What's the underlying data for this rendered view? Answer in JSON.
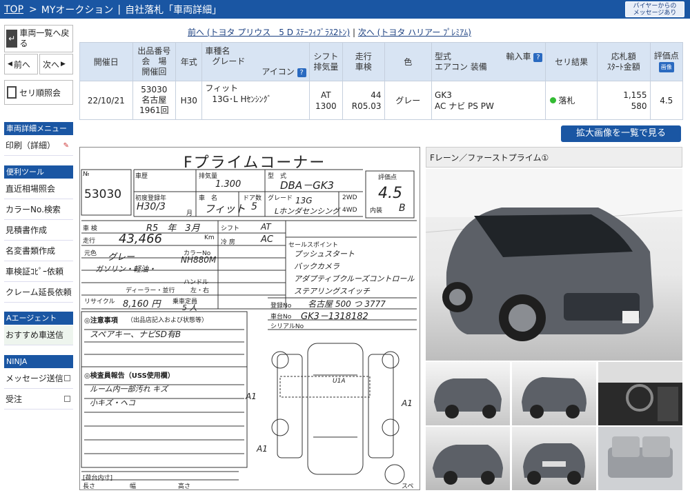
{
  "header": {
    "top_link": "TOP",
    "sep": ">",
    "my": "MYオークション",
    "bar": "|",
    "title": "自社落札「車両詳細」",
    "buyer_msg_line1": "バイヤーからの",
    "buyer_msg_line2": "メッセージあり"
  },
  "sidebar": {
    "back_list": "車両一覧へ戻る",
    "prev": "前へ",
    "next": "次へ",
    "seri": "セリ順照会",
    "menu_head": "車両詳細メニュー",
    "print": "印刷（詳細）",
    "tools_head": "便利ツール",
    "tools": [
      "直近相場照会",
      "カラーNo.検索",
      "見積書作成",
      "名変書類作成",
      "車検証ｺﾋﾟｰ依頼",
      "クレーム延長依頼"
    ],
    "agent_head": "Aエージェント",
    "agent_item": "おすすめ車送信",
    "ninja_head": "NINJA",
    "ninja_items": [
      "メッセージ送信",
      "受注"
    ]
  },
  "navline": {
    "prev": "前へ (トヨタ プリウス　5 D ｽﾃｰﾌｨﾌﾞﾗｽ2ﾄﾝ)",
    "divider": "|",
    "next": "次へ (トヨタ ハリアー ﾌﾟﾚﾐｱﾑ)"
  },
  "table": {
    "headers": {
      "date": "開催日",
      "lot1": "出品番号",
      "lot2": "会　場",
      "lot3": "開催回",
      "year": "年式",
      "model1": "車種名",
      "model2": "グレード",
      "model3": "アイコン",
      "shift1": "シフト",
      "shift2": "排気量",
      "mile1": "走行",
      "mile2": "車検",
      "color": "色",
      "type1": "型式",
      "type1b": "輸入車",
      "type2": "エアコン 装備",
      "result": "セリ結果",
      "price1": "応札額",
      "price2": "ｽﾀｰﾄ金額",
      "score": "評価点",
      "score_badge": "画像"
    },
    "row": {
      "date": "22/10/21",
      "lot": "53030",
      "venue": "名古屋",
      "kai": "1961回",
      "year": "H30",
      "model": "フィット",
      "grade": "13G･L Hｾﾝｼﾝｸﾞ",
      "shift": "AT",
      "cc": "1300",
      "mileage": "44",
      "inspection": "R05.03",
      "color": "グレー",
      "katashiki": "GK3",
      "equip": "AC ナビ PS PW",
      "result": "落札",
      "bid": "1,155",
      "start": "580",
      "score": "4.5"
    }
  },
  "zoom_button": "拡大画像を一覧で見る",
  "sheet": {
    "title": "Fプライムコーナー",
    "lot": "53030",
    "lot_label": "№",
    "regist": "車歴",
    "cc_label": "排気量",
    "cc": "1.300",
    "type_label": "型　式",
    "type": "DBA－GK3",
    "score_label": "評価点",
    "score": "4.5",
    "interior_label": "内装",
    "interior": "B",
    "year_label": "初度登録年",
    "year": "H30/3",
    "year_unit": "月",
    "name_label": "車　名",
    "name": "フィット",
    "doors_label": "ドア数",
    "doors": "5",
    "grade_label": "グレード",
    "grade1": "13G",
    "grade2": "Lホンダセンシング",
    "wd1": "2WD",
    "wd2": "4WD",
    "shaken_label": "車 検",
    "shaken": "R5　年　3月",
    "mile_label": "走行",
    "mile": "43,466",
    "km": "Km",
    "shift_label": "シフト",
    "shift": "AT",
    "ac_label": "冷 房",
    "ac": "AC",
    "color_label": "元色",
    "color": "グレー",
    "colorno_label": "カラーNo",
    "colorno": "NH880M",
    "fuel": "ガソリン・軽油・",
    "dealer": "ディーラー・並行",
    "handle_label": "ハンドル",
    "handle": "左・右",
    "recycle_label": "リサイクル",
    "recycle": "8,160 円",
    "seats_label": "乗車定員",
    "seats": "5 人",
    "reg_label": "登録No",
    "reg": "名古屋 500 つ 3777",
    "chassis_label": "車台No",
    "chassis": "GK3－1318182",
    "serial_label": "シリアルNo",
    "sales_label": "セールスポイント",
    "sales": [
      "プッシュスタート",
      "バックカメラ",
      "アダプティブクルーズコントロール",
      "ステアリングスイッチ"
    ],
    "notes_label": "◎注意事項",
    "notes_sub": "（出品店記入および状態等）",
    "notes": "スペアキー、ナビSD有B",
    "inspector_label": "◎検査員報告（USS使用欄）",
    "inspector_lines": [
      "ルーム内一部汚れ キズ",
      "小キズ・ヘコ"
    ],
    "diagram_marks": [
      "A1",
      "A1",
      "A1",
      "U1A"
    ],
    "spare": "スペア",
    "bottom": [
      "長さ",
      "幅",
      "高さ"
    ],
    "bottom_head": "[荷台内寸]"
  },
  "photos": {
    "caption": "Fレーン／ファーストプライム①"
  }
}
